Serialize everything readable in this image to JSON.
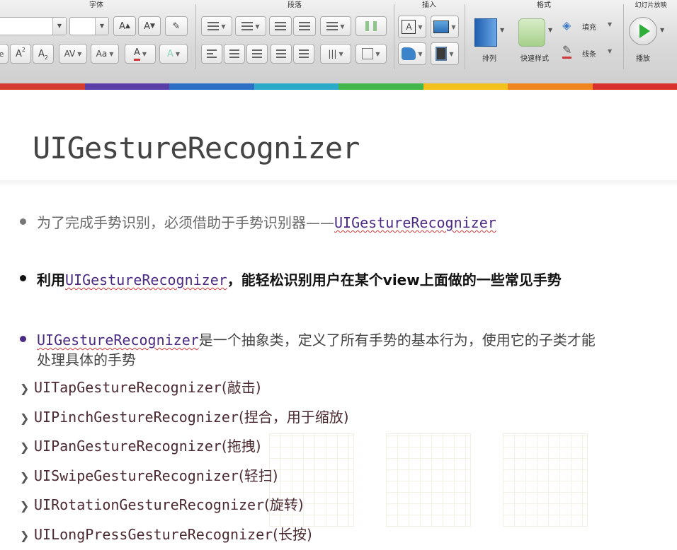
{
  "ribbon": {
    "groups": {
      "font": "字体",
      "paragraph": "段落",
      "insert": "插入",
      "format": "格式",
      "slideshow": "幻灯片放映"
    },
    "buttons": {
      "arrange": "排列",
      "quick_styles": "快速样式",
      "fill": "填充",
      "line": "线条",
      "play": "播放"
    },
    "glyphs": {
      "grow_font": "A",
      "shrink_font": "A",
      "superscript": "A",
      "subscript": "A",
      "char_spacing": "AV",
      "change_case": "Aa",
      "font_color": "A",
      "text_effects": "A"
    },
    "colors": {
      "font_color_bar": "#d0363a",
      "play_green": "#2fae3a"
    }
  },
  "color_bar": [
    "#d63b2f",
    "#5b3fa8",
    "#2b6fc7",
    "#2aa9c9",
    "#43b649",
    "#f2c11c",
    "#f0841f",
    "#d9322c"
  ],
  "slide": {
    "title": "UIGestureRecognizer",
    "bullets": [
      {
        "text_a": "为了完成手势识别，必须借助于手势识别器——",
        "code": "UIGestureRecognizer",
        "text_b": ""
      },
      {
        "text_a": "利用",
        "code": "UIGestureRecognizer",
        "text_b": "，能轻松识别用户在某个view上面做的一些常见手势"
      },
      {
        "text_a": "",
        "code": "UIGestureRecognizer",
        "text_b": "是一个抽象类，定义了所有手势的基本行为，使用它的子类才能",
        "text_c": "处理具体的手势"
      }
    ],
    "subclasses": [
      {
        "name": "UITapGestureRecognizer",
        "desc": "(敲击)"
      },
      {
        "name": "UIPinchGestureRecognizer",
        "desc": "(捏合，用于缩放)"
      },
      {
        "name": "UIPanGestureRecognizer",
        "desc": "(拖拽)"
      },
      {
        "name": "UISwipeGestureRecognizer",
        "desc": "(轻扫)"
      },
      {
        "name": "UIRotationGestureRecognizer",
        "desc": "(旋转)"
      },
      {
        "name": "UILongPressGestureRecognizer",
        "desc": "(长按)"
      }
    ],
    "colors": {
      "title": "#444444",
      "bullet_1_text": "#6a6a6a",
      "bullet_2_text": "#111111",
      "bullet_3_text": "#444444",
      "code_link": "#4b2a83",
      "subclass": "#4a2a30"
    }
  }
}
